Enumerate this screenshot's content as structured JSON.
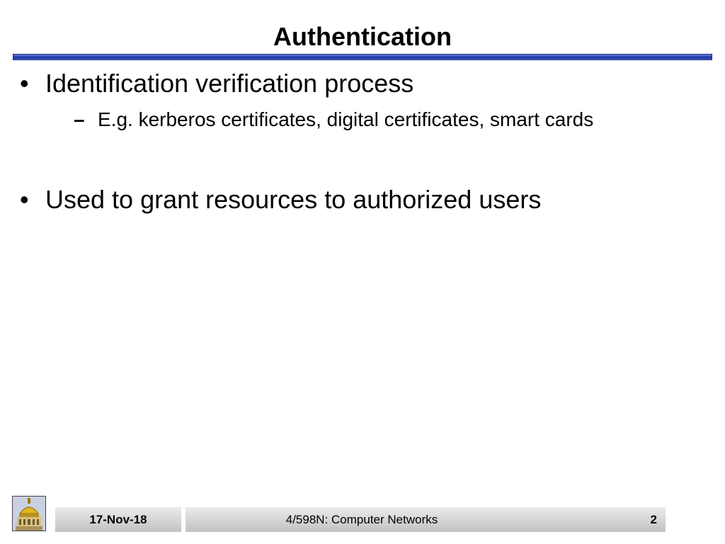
{
  "slide": {
    "title": "Authentication",
    "bullets": [
      {
        "text": "Identification verification process",
        "symbol": "•",
        "sub_bullets": [
          {
            "symbol": "–",
            "text": "E.g. kerberos certificates, digital certificates, smart cards"
          }
        ]
      },
      {
        "text": "Used to grant resources to authorized users",
        "symbol": "•",
        "sub_bullets": []
      }
    ]
  },
  "footer": {
    "date": "17-Nov-18",
    "course": "4/598N: Computer Networks",
    "page_number": "2",
    "logo_icon": "golden-dome-icon"
  },
  "colors": {
    "title_bar": "#2a44b8",
    "footer_bar": "#d2d2d2",
    "text": "#000000"
  }
}
